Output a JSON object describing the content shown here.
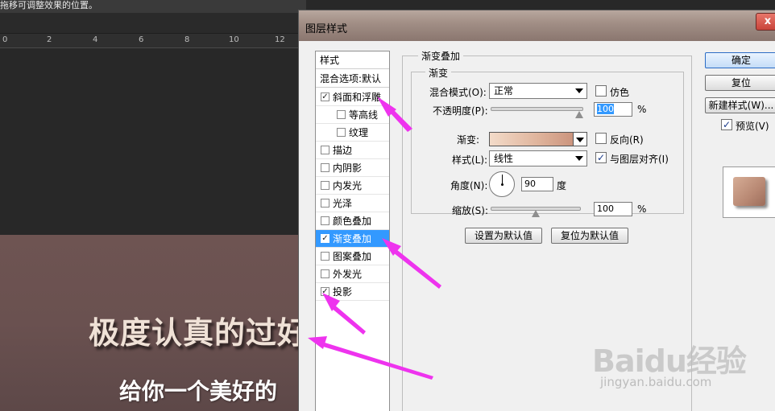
{
  "background": {
    "hint_text": "拖移可调整效果的位置。",
    "ruler_ticks": [
      "0",
      "2",
      "4",
      "6",
      "8",
      "10",
      "12"
    ],
    "canvas_title": "极度认真的过好",
    "canvas_subtitle": "给你一个美好的"
  },
  "dialog": {
    "title": "图层样式",
    "close_label": "x",
    "styles_header": "样式",
    "blend_default": "混合选项:默认",
    "style_items": [
      {
        "label": "斜面和浮雕",
        "checked": true
      },
      {
        "label": "等高线",
        "checked": false
      },
      {
        "label": "纹理",
        "checked": false
      },
      {
        "label": "描边",
        "checked": false
      },
      {
        "label": "内阴影",
        "checked": false
      },
      {
        "label": "内发光",
        "checked": false
      },
      {
        "label": "光泽",
        "checked": false
      },
      {
        "label": "颜色叠加",
        "checked": false
      },
      {
        "label": "渐变叠加",
        "checked": true,
        "selected": true
      },
      {
        "label": "图案叠加",
        "checked": false
      },
      {
        "label": "外发光",
        "checked": false
      },
      {
        "label": "投影",
        "checked": true
      }
    ],
    "panel": {
      "group_title": "渐变叠加",
      "sub_title": "渐变",
      "blend_mode_label": "混合模式(O):",
      "blend_mode_value": "正常",
      "dither_label": "仿色",
      "dither_checked": false,
      "opacity_label": "不透明度(P):",
      "opacity_value": "100",
      "opacity_unit": "%",
      "opacity_fraction": 1.0,
      "gradient_label": "渐变:",
      "gradient_colors": [
        "#f3dbc9",
        "#dfb49c",
        "#c48872"
      ],
      "reverse_label": "反向(R)",
      "reverse_checked": false,
      "style_label": "样式(L):",
      "style_value": "线性",
      "align_label": "与图层对齐(I)",
      "align_checked": true,
      "angle_label": "角度(N):",
      "angle_value": "90",
      "angle_unit": "度",
      "scale_label": "缩放(S):",
      "scale_value": "100",
      "scale_unit": "%",
      "scale_fraction": 0.5,
      "set_default_label": "设置为默认值",
      "reset_default_label": "复位为默认值"
    },
    "buttons": {
      "ok": "确定",
      "reset": "复位",
      "new_style": "新建样式(W)...",
      "preview_label": "预览(V)",
      "preview_checked": true
    }
  },
  "watermark": {
    "logo": "Baidu经验",
    "site": "jingyan.baidu.com"
  },
  "colors": {
    "selection": "#3399ff",
    "annotation_arrow": "#ee33ee"
  }
}
